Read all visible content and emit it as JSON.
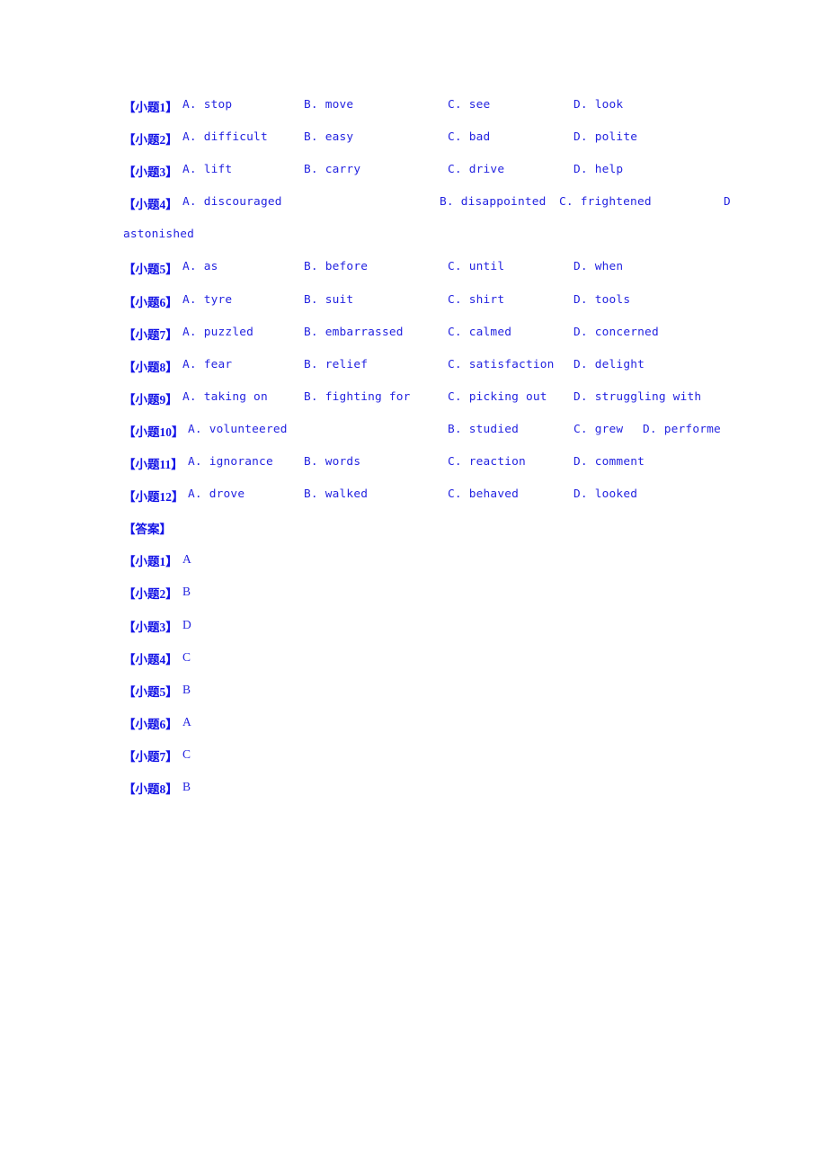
{
  "document": {
    "text_color": "#2323e0",
    "label_color": "#1414e6",
    "background": "#ffffff"
  },
  "questions": [
    {
      "label_prefix": "【小题",
      "label_suffix": "】",
      "number": "1",
      "layout": "standard",
      "options": [
        {
          "key": "A.",
          "text": "stop"
        },
        {
          "key": "B.",
          "text": "move"
        },
        {
          "key": "C.",
          "text": "see"
        },
        {
          "key": "D.",
          "text": "look"
        }
      ]
    },
    {
      "label_prefix": "【小题",
      "label_suffix": "】",
      "number": "2",
      "layout": "standard",
      "options": [
        {
          "key": "A.",
          "text": "difficult"
        },
        {
          "key": "B.",
          "text": "easy"
        },
        {
          "key": "C.",
          "text": "bad"
        },
        {
          "key": "D.",
          "text": "polite"
        }
      ]
    },
    {
      "label_prefix": "【小题",
      "label_suffix": "】",
      "number": "3",
      "layout": "standard",
      "options": [
        {
          "key": "A.",
          "text": "lift"
        },
        {
          "key": "B.",
          "text": "carry"
        },
        {
          "key": "C.",
          "text": "drive"
        },
        {
          "key": "D.",
          "text": "help"
        }
      ]
    },
    {
      "label_prefix": "【小题",
      "label_suffix": "】",
      "number": "4",
      "layout": "wide",
      "wrapped_text": "astonished",
      "options": [
        {
          "key": "A.",
          "text": "discouraged"
        },
        {
          "key": "B.",
          "text": "disappointed"
        },
        {
          "key": "C.",
          "text": "frightened"
        },
        {
          "key": "D",
          "text": ""
        }
      ]
    },
    {
      "label_prefix": "【小题",
      "label_suffix": "】",
      "number": "5",
      "layout": "standard",
      "options": [
        {
          "key": "A.",
          "text": "as"
        },
        {
          "key": "B.",
          "text": "before"
        },
        {
          "key": "C.",
          "text": "until"
        },
        {
          "key": "D.",
          "text": "when"
        }
      ]
    },
    {
      "label_prefix": "【小题",
      "label_suffix": "】",
      "number": "6",
      "layout": "standard",
      "options": [
        {
          "key": "A.",
          "text": "tyre"
        },
        {
          "key": "B.",
          "text": "suit"
        },
        {
          "key": "C.",
          "text": "shirt"
        },
        {
          "key": "D.",
          "text": "tools"
        }
      ]
    },
    {
      "label_prefix": "【小题",
      "label_suffix": "】",
      "number": "7",
      "layout": "standard",
      "options": [
        {
          "key": "A.",
          "text": "puzzled"
        },
        {
          "key": "B.",
          "text": "embarrassed"
        },
        {
          "key": "C.",
          "text": "calmed"
        },
        {
          "key": "D.",
          "text": "concerned"
        }
      ]
    },
    {
      "label_prefix": "【小题",
      "label_suffix": "】",
      "number": "8",
      "layout": "standard",
      "options": [
        {
          "key": "A.",
          "text": "fear"
        },
        {
          "key": "B.",
          "text": "relief"
        },
        {
          "key": "C.",
          "text": "satisfaction"
        },
        {
          "key": "D.",
          "text": "delight"
        }
      ]
    },
    {
      "label_prefix": "【小题",
      "label_suffix": "】",
      "number": "9",
      "layout": "standard",
      "options": [
        {
          "key": "A.",
          "text": "taking on"
        },
        {
          "key": "B.",
          "text": "fighting for"
        },
        {
          "key": "C.",
          "text": "picking out"
        },
        {
          "key": "D.",
          "text": "struggling with"
        }
      ]
    },
    {
      "label_prefix": "【小题",
      "label_suffix": "】",
      "number": "10",
      "layout": "compressed",
      "options": [
        {
          "key": "A.",
          "text": "volunteered"
        },
        {
          "key": "B.",
          "text": "studied"
        },
        {
          "key": "C.",
          "text": "grew"
        },
        {
          "key": "D.",
          "text": "performe"
        }
      ]
    },
    {
      "label_prefix": "【小题",
      "label_suffix": "】",
      "number": "11",
      "layout": "standard",
      "options": [
        {
          "key": "A.",
          "text": "ignorance"
        },
        {
          "key": "B.",
          "text": "words"
        },
        {
          "key": "C.",
          "text": "reaction"
        },
        {
          "key": "D.",
          "text": "comment"
        }
      ]
    },
    {
      "label_prefix": "【小题",
      "label_suffix": "】",
      "number": "12",
      "layout": "standard",
      "options": [
        {
          "key": "A.",
          "text": "drove"
        },
        {
          "key": "B.",
          "text": "walked"
        },
        {
          "key": "C.",
          "text": "behaved"
        },
        {
          "key": "D.",
          "text": "looked"
        }
      ]
    }
  ],
  "answers_section": {
    "header": "【答案】",
    "label_prefix": "【小题",
    "label_suffix": "】",
    "items": [
      {
        "number": "1",
        "answer": "A"
      },
      {
        "number": "2",
        "answer": "B"
      },
      {
        "number": "3",
        "answer": "D"
      },
      {
        "number": "4",
        "answer": "C"
      },
      {
        "number": "5",
        "answer": "B"
      },
      {
        "number": "6",
        "answer": "A"
      },
      {
        "number": "7",
        "answer": "C"
      },
      {
        "number": "8",
        "answer": "B"
      }
    ]
  }
}
